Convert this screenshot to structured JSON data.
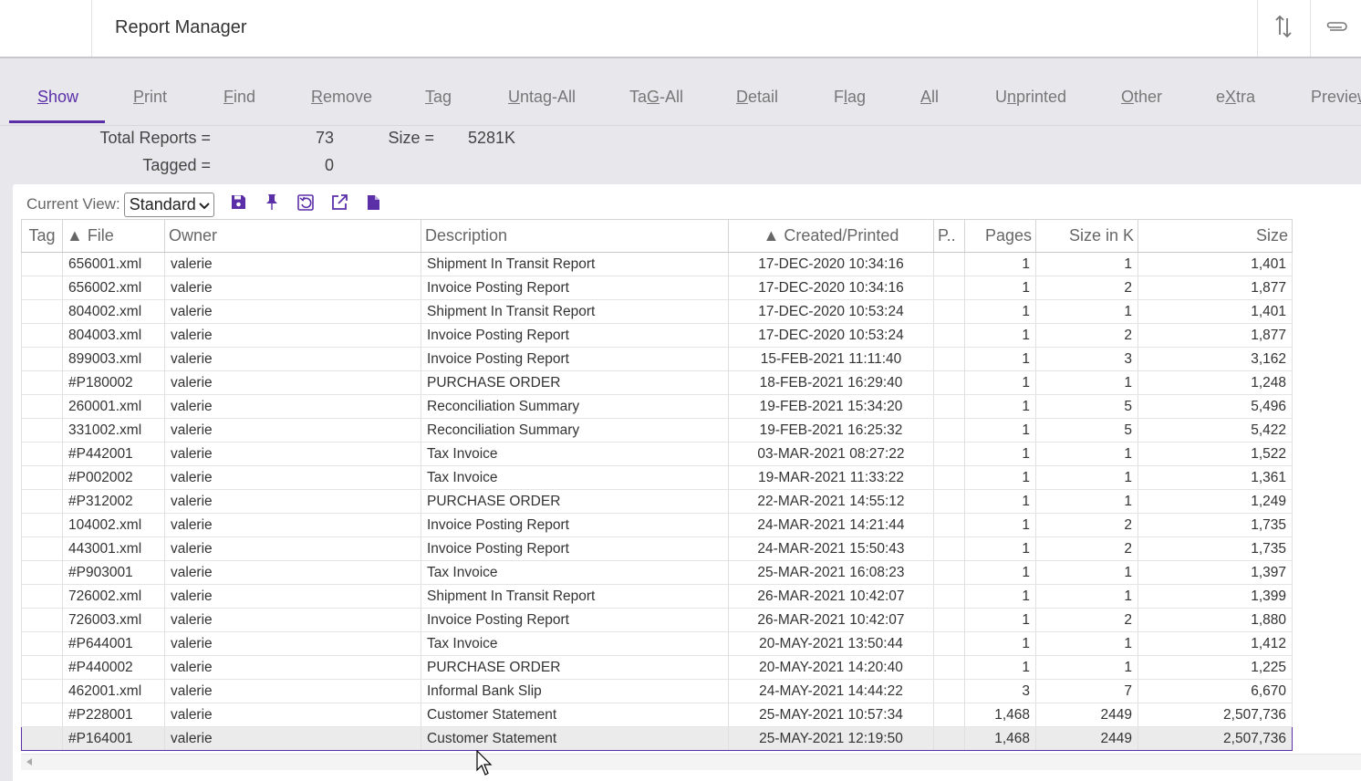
{
  "app": {
    "title": "Report Manager"
  },
  "tabs": [
    {
      "label": "Show",
      "underline": "S",
      "rest": "how",
      "active": true
    },
    {
      "label": "Print",
      "underline": "P",
      "rest": "rint",
      "active": false
    },
    {
      "label": "Find",
      "underline": "F",
      "rest": "ind",
      "active": false
    },
    {
      "label": "Remove",
      "underline": "R",
      "rest": "emove",
      "active": false
    },
    {
      "label": "Tag",
      "underline": "T",
      "rest": "ag",
      "active": false
    },
    {
      "label": "Untag-All",
      "underline": "U",
      "rest": "ntag-All",
      "active": false
    },
    {
      "label": "TaG-All",
      "pre": "Ta",
      "underline": "G",
      "rest": "-All",
      "active": false
    },
    {
      "label": "Detail",
      "underline": "D",
      "rest": "etail",
      "active": false
    },
    {
      "label": "Flag",
      "pre": "F",
      "underline": "l",
      "rest": "ag",
      "active": false
    },
    {
      "label": "All",
      "underline": "A",
      "rest": "ll",
      "active": false
    },
    {
      "label": "Unprinted",
      "pre": "U",
      "underline": "n",
      "rest": "printed",
      "active": false
    },
    {
      "label": "Other",
      "underline": "O",
      "rest": "ther",
      "active": false
    },
    {
      "label": "eXtra",
      "pre": "e",
      "underline": "X",
      "rest": "tra",
      "active": false
    },
    {
      "label": "Preview",
      "pre": "Previe",
      "underline": "w",
      "rest": "",
      "active": false
    }
  ],
  "summary": {
    "total_label": "Total Reports =",
    "total_value": "73",
    "size_label": "Size =",
    "size_value": "5281K",
    "tagged_label": "Tagged =",
    "tagged_value": "0"
  },
  "view": {
    "label": "Current View:",
    "selected": "Standard"
  },
  "toolbar_icons": [
    "save-icon",
    "pin-icon",
    "restore-view-icon",
    "export-icon",
    "document-icon"
  ],
  "columns": {
    "tag": "Tag",
    "file": "▲ File",
    "owner": "Owner",
    "description": "Description",
    "created": "▲ Created/Printed",
    "p": "P..",
    "pages": "Pages",
    "size_k": "Size in K",
    "size": "Size"
  },
  "rows": [
    {
      "tag": "",
      "file": "656001.xml",
      "owner": "valerie",
      "description": "Shipment In Transit Report",
      "created": "17-DEC-2020 10:34:16",
      "p": "",
      "pages": "1",
      "size_k": "1",
      "size": "1,401"
    },
    {
      "tag": "",
      "file": "656002.xml",
      "owner": "valerie",
      "description": "Invoice Posting Report",
      "created": "17-DEC-2020 10:34:16",
      "p": "",
      "pages": "1",
      "size_k": "2",
      "size": "1,877"
    },
    {
      "tag": "",
      "file": "804002.xml",
      "owner": "valerie",
      "description": "Shipment In Transit Report",
      "created": "17-DEC-2020 10:53:24",
      "p": "",
      "pages": "1",
      "size_k": "1",
      "size": "1,401"
    },
    {
      "tag": "",
      "file": "804003.xml",
      "owner": "valerie",
      "description": "Invoice Posting Report",
      "created": "17-DEC-2020 10:53:24",
      "p": "",
      "pages": "1",
      "size_k": "2",
      "size": "1,877"
    },
    {
      "tag": "",
      "file": "899003.xml",
      "owner": "valerie",
      "description": "Invoice Posting Report",
      "created": "15-FEB-2021 11:11:40",
      "p": "",
      "pages": "1",
      "size_k": "3",
      "size": "3,162"
    },
    {
      "tag": "",
      "file": "#P180002",
      "owner": "valerie",
      "description": "PURCHASE ORDER",
      "created": "18-FEB-2021 16:29:40",
      "p": "",
      "pages": "1",
      "size_k": "1",
      "size": "1,248"
    },
    {
      "tag": "",
      "file": "260001.xml",
      "owner": "valerie",
      "description": "Reconciliation Summary",
      "created": "19-FEB-2021 15:34:20",
      "p": "",
      "pages": "1",
      "size_k": "5",
      "size": "5,496"
    },
    {
      "tag": "",
      "file": "331002.xml",
      "owner": "valerie",
      "description": "Reconciliation Summary",
      "created": "19-FEB-2021 16:25:32",
      "p": "",
      "pages": "1",
      "size_k": "5",
      "size": "5,422"
    },
    {
      "tag": "",
      "file": "#P442001",
      "owner": "valerie",
      "description": "Tax Invoice",
      "created": "03-MAR-2021 08:27:22",
      "p": "",
      "pages": "1",
      "size_k": "1",
      "size": "1,522"
    },
    {
      "tag": "",
      "file": "#P002002",
      "owner": "valerie",
      "description": "Tax Invoice",
      "created": "19-MAR-2021 11:33:22",
      "p": "",
      "pages": "1",
      "size_k": "1",
      "size": "1,361"
    },
    {
      "tag": "",
      "file": "#P312002",
      "owner": "valerie",
      "description": "PURCHASE ORDER",
      "created": "22-MAR-2021 14:55:12",
      "p": "",
      "pages": "1",
      "size_k": "1",
      "size": "1,249"
    },
    {
      "tag": "",
      "file": "104002.xml",
      "owner": "valerie",
      "description": "Invoice Posting Report",
      "created": "24-MAR-2021 14:21:44",
      "p": "",
      "pages": "1",
      "size_k": "2",
      "size": "1,735"
    },
    {
      "tag": "",
      "file": "443001.xml",
      "owner": "valerie",
      "description": "Invoice Posting Report",
      "created": "24-MAR-2021 15:50:43",
      "p": "",
      "pages": "1",
      "size_k": "2",
      "size": "1,735"
    },
    {
      "tag": "",
      "file": "#P903001",
      "owner": "valerie",
      "description": "Tax Invoice",
      "created": "25-MAR-2021 16:08:23",
      "p": "",
      "pages": "1",
      "size_k": "1",
      "size": "1,397"
    },
    {
      "tag": "",
      "file": "726002.xml",
      "owner": "valerie",
      "description": "Shipment In Transit Report",
      "created": "26-MAR-2021 10:42:07",
      "p": "",
      "pages": "1",
      "size_k": "1",
      "size": "1,399"
    },
    {
      "tag": "",
      "file": "726003.xml",
      "owner": "valerie",
      "description": "Invoice Posting Report",
      "created": "26-MAR-2021 10:42:07",
      "p": "",
      "pages": "1",
      "size_k": "2",
      "size": "1,880"
    },
    {
      "tag": "",
      "file": "#P644001",
      "owner": "valerie",
      "description": "Tax Invoice",
      "created": "20-MAY-2021 13:50:44",
      "p": "",
      "pages": "1",
      "size_k": "1",
      "size": "1,412"
    },
    {
      "tag": "",
      "file": "#P440002",
      "owner": "valerie",
      "description": "PURCHASE ORDER",
      "created": "20-MAY-2021 14:20:40",
      "p": "",
      "pages": "1",
      "size_k": "1",
      "size": "1,225"
    },
    {
      "tag": "",
      "file": "462001.xml",
      "owner": "valerie",
      "description": "Informal Bank Slip",
      "created": "24-MAY-2021 14:44:22",
      "p": "",
      "pages": "3",
      "size_k": "7",
      "size": "6,670"
    },
    {
      "tag": "",
      "file": "#P228001",
      "owner": "valerie",
      "description": "Customer Statement",
      "created": "25-MAY-2021 10:57:34",
      "p": "",
      "pages": "1,468",
      "size_k": "2449",
      "size": "2,507,736"
    },
    {
      "tag": "",
      "file": "#P164001",
      "owner": "valerie",
      "description": "Customer Statement",
      "created": "25-MAY-2021 12:19:50",
      "p": "",
      "pages": "1,468",
      "size_k": "2449",
      "size": "2,507,736",
      "selected": true
    }
  ],
  "colors": {
    "accent": "#5b2fa8",
    "background": "#e8e8ec",
    "selected_row": "#ebebeb"
  }
}
